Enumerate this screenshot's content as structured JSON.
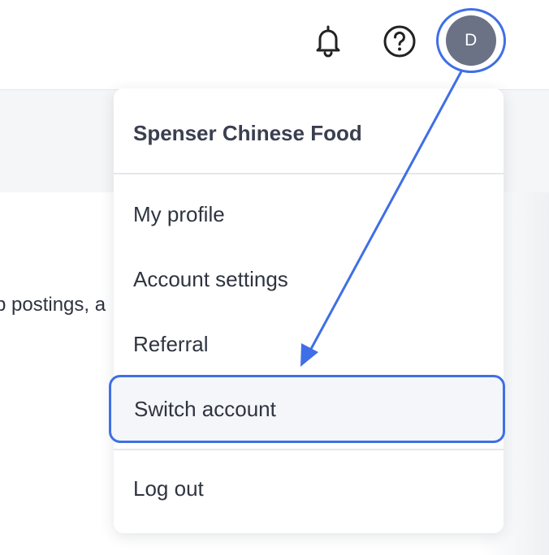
{
  "topbar": {
    "icons": {
      "notifications": "bell-icon",
      "help": "help-circle-icon"
    },
    "avatar_initial": "D"
  },
  "background": {
    "partial_text": "p postings, a"
  },
  "menu": {
    "account_name": "Spenser Chinese Food",
    "items": [
      {
        "label": "My profile"
      },
      {
        "label": "Account settings"
      },
      {
        "label": "Referral"
      },
      {
        "label": "Switch account"
      },
      {
        "label": "Log out"
      }
    ]
  },
  "colors": {
    "highlight": "#3f6fe6",
    "avatar_bg": "#6b7285",
    "text": "#2f3441"
  }
}
